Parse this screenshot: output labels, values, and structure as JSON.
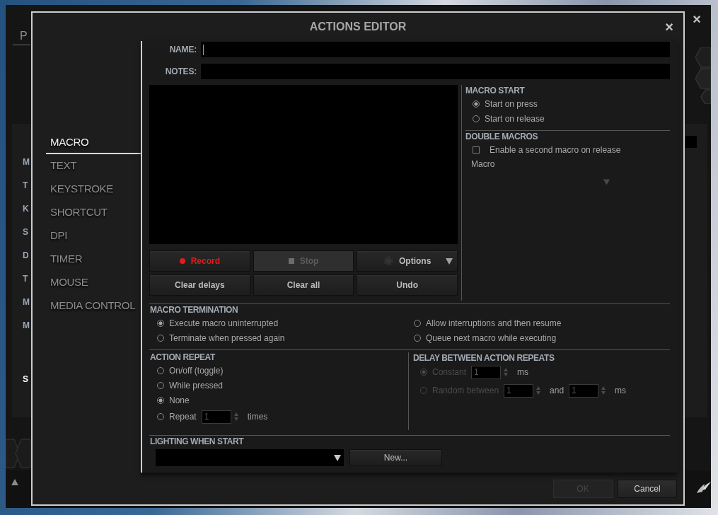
{
  "background_app": {
    "tab": "P",
    "close": "×",
    "sidebar_letters": [
      "M",
      "T",
      "K",
      "S",
      "D",
      "T",
      "M",
      "M"
    ],
    "highlighted_letter": "S"
  },
  "dialog": {
    "title": "ACTIONS EDITOR",
    "close": "×",
    "categories": [
      {
        "label": "MACRO",
        "selected": true
      },
      {
        "label": "TEXT",
        "selected": false
      },
      {
        "label": "KEYSTROKE",
        "selected": false
      },
      {
        "label": "SHORTCUT",
        "selected": false
      },
      {
        "label": "DPI",
        "selected": false
      },
      {
        "label": "TIMER",
        "selected": false
      },
      {
        "label": "MOUSE",
        "selected": false
      },
      {
        "label": "MEDIA CONTROL",
        "selected": false
      }
    ],
    "name_field": {
      "label": "NAME:",
      "focused": true
    },
    "notes_field": {
      "label": "NOTES:",
      "focused": false
    },
    "macro_start": {
      "title": "MACRO START",
      "options": [
        {
          "label": "Start on press",
          "selected": true
        },
        {
          "label": "Start on release",
          "selected": false
        }
      ]
    },
    "double_macros": {
      "title": "DOUBLE MACROS",
      "checkbox": {
        "label": "Enable a second macro on release",
        "checked": false
      },
      "macro_label": "Macro",
      "dropdown": {
        "disabled": true
      }
    },
    "record_buttons": [
      {
        "kind": "record",
        "label": "Record",
        "disabled": false
      },
      {
        "kind": "stop",
        "label": "Stop",
        "disabled": true
      },
      {
        "kind": "options",
        "label": "Options",
        "disabled": false
      }
    ],
    "edit_buttons": [
      "Clear delays",
      "Clear all",
      "Undo"
    ],
    "macro_termination": {
      "title": "MACRO TERMINATION",
      "options": [
        {
          "label": "Execute macro uninterrupted",
          "selected": true
        },
        {
          "label": "Allow interruptions and then resume",
          "selected": false
        },
        {
          "label": "Terminate when pressed again",
          "selected": false
        },
        {
          "label": "Queue next macro while executing",
          "selected": false
        }
      ]
    },
    "action_repeat": {
      "title": "ACTION REPEAT",
      "options": [
        {
          "kind": "plain",
          "label": "On/off (toggle)",
          "selected": false
        },
        {
          "kind": "plain",
          "label": "While pressed",
          "selected": false
        },
        {
          "kind": "plain",
          "label": "None",
          "selected": true
        },
        {
          "kind": "count",
          "label": "Repeat",
          "selected": false,
          "value": "1",
          "unit": "times"
        }
      ]
    },
    "delay_between_repeats": {
      "title": "DELAY BETWEEN ACTION REPEATS",
      "disabled": true,
      "options": [
        {
          "kind": "single",
          "label": "Constant",
          "selected": true,
          "value": "1",
          "unit": "ms"
        },
        {
          "kind": "range",
          "label": "Random between",
          "selected": false,
          "value": "1",
          "joiner": "and",
          "value_to": "1",
          "unit": "ms"
        }
      ]
    },
    "lighting": {
      "title": "LIGHTING WHEN START",
      "new_button": "New..."
    },
    "footer_buttons": [
      {
        "label": "OK",
        "disabled": true
      },
      {
        "label": "Cancel",
        "disabled": false
      }
    ]
  }
}
